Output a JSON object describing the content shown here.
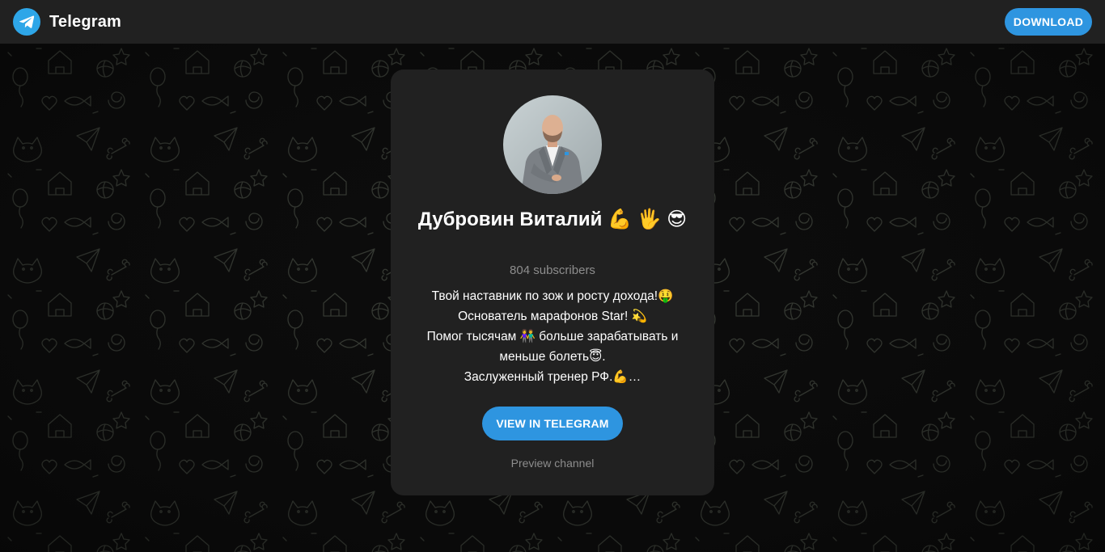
{
  "header": {
    "app_name": "Telegram",
    "download_label": "DOWNLOAD",
    "logo_icon": "telegram-paper-plane-icon"
  },
  "channel": {
    "title": "Дубровин Виталий 💪 🖐 😎",
    "subscribers": "804 subscribers",
    "description_lines": [
      "Твой наставник по зож и росту дохода!🤑",
      "Основатель марафонов Star! 💫",
      "Помог тысячам 👫 больше зарабатывать и",
      "меньше болеть😇.",
      "Заслуженный тренер РФ.💪…"
    ],
    "avatar_icon": "channel-avatar"
  },
  "actions": {
    "view_label": "VIEW IN TELEGRAM",
    "preview_label": "Preview channel"
  },
  "colors": {
    "accent": "#2e95e0",
    "header_bg": "#212121",
    "card_bg": "#212121",
    "page_bg": "#0c0c0c",
    "muted_text": "#8d8d8d"
  }
}
